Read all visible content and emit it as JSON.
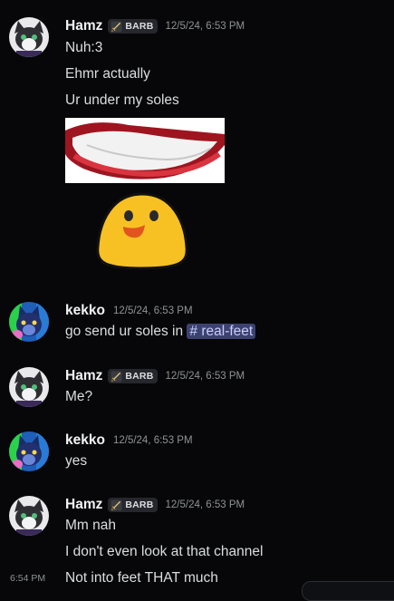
{
  "messages": [
    {
      "username": "Hamz",
      "tag": "BARB",
      "timestamp": "12/5/24, 6:53 PM",
      "lines": [
        "Nuh:3",
        "Ehmr actually",
        "Ur under my soles"
      ]
    },
    {
      "username": "kekko",
      "timestamp": "12/5/24, 6:53 PM",
      "text_before": "go send ur soles in",
      "mention": "# real-feet"
    },
    {
      "username": "Hamz",
      "tag": "BARB",
      "timestamp": "12/5/24, 6:53 PM",
      "lines": [
        "Me?"
      ]
    },
    {
      "username": "kekko",
      "timestamp": "12/5/24, 6:53 PM",
      "lines": [
        "yes"
      ]
    },
    {
      "username": "Hamz",
      "tag": "BARB",
      "timestamp": "12/5/24, 6:53 PM",
      "lines": [
        "Mm nah",
        "I don't even look at that channel",
        "Not into feet THAT much"
      ],
      "hover_timestamp": "6:54 PM"
    }
  ],
  "colors": {
    "background": "#070709",
    "mention_bg": "#3c4270",
    "mention_text": "#c9cdfb"
  },
  "icons": [
    "sword-icon",
    "teeth-sticker",
    "smiling-blob-sticker"
  ]
}
